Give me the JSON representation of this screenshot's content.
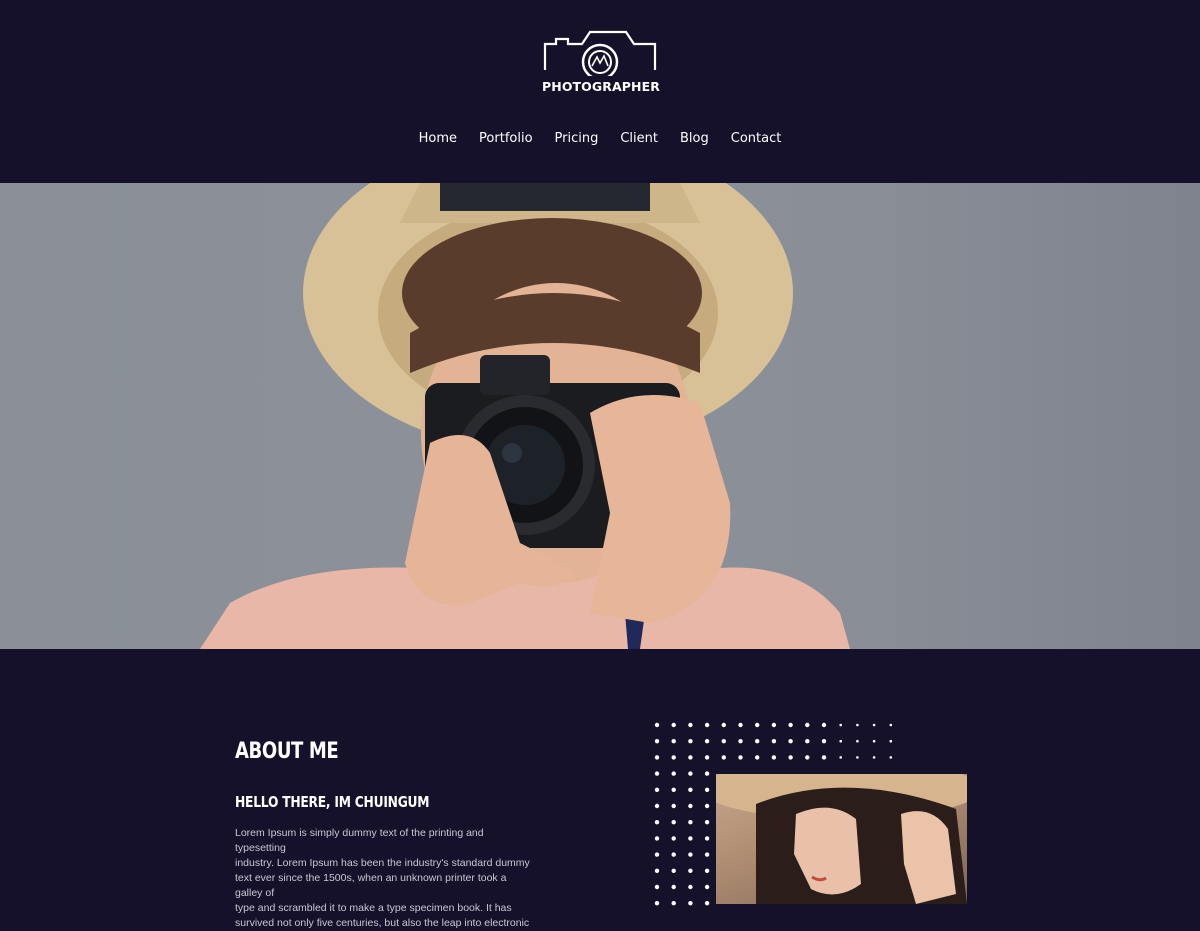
{
  "brand": {
    "logo_text": "PHOTOGRAPHER",
    "logo_icon": "camera-icon"
  },
  "nav": {
    "items": [
      {
        "label": "Home"
      },
      {
        "label": "Portfolio"
      },
      {
        "label": "Pricing"
      },
      {
        "label": "Client"
      },
      {
        "label": "Blog"
      },
      {
        "label": "Contact"
      }
    ]
  },
  "hero": {
    "image": "photographer-with-camera-photo"
  },
  "about": {
    "title": "ABOUT ME",
    "subtitle": "HELLO THERE, IM CHUINGUM",
    "body_lines": [
      "Lorem Ipsum is simply dummy text of the printing and typesetting",
      "industry. Lorem Ipsum has been the industry's standard dummy",
      "text ever since the 1500s, when an unknown printer took a galley of",
      "type and scrambled it to make a type specimen book. It has",
      "survived not only five centuries, but also the leap into electronic"
    ],
    "image": "woman-in-hat-portrait"
  },
  "colors": {
    "background": "#15112b",
    "text": "#ffffff",
    "body_text": "#c9c7d3"
  }
}
